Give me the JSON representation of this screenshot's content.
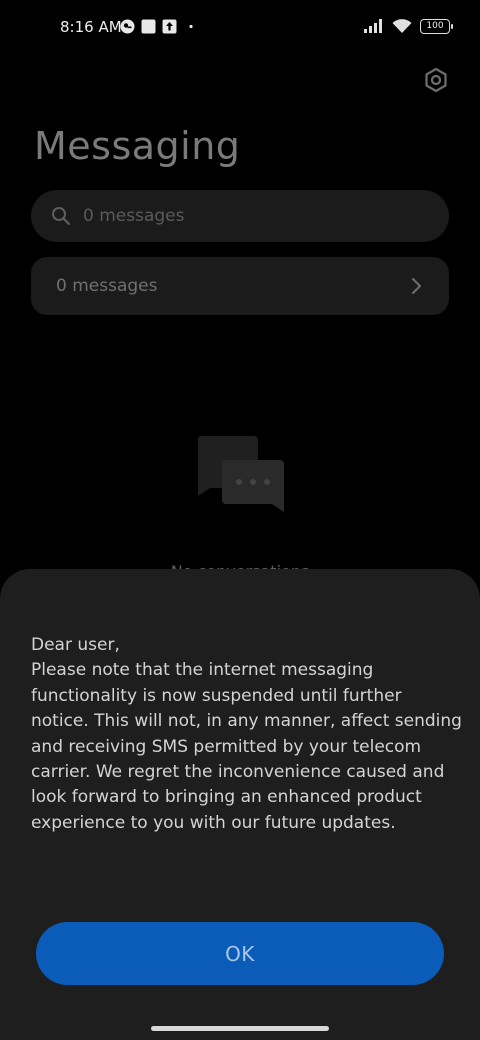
{
  "status_bar": {
    "time": "8:16 AM",
    "battery": "100",
    "left_icons": [
      "vpn-key-icon",
      "square-notification-icon",
      "upload-notification-icon",
      "dot-icon"
    ],
    "right_icons": [
      "signal-icon",
      "wifi-icon",
      "battery-icon"
    ]
  },
  "header": {
    "title": "Messaging",
    "settings_icon": "gear-icon"
  },
  "search": {
    "placeholder": "0 messages"
  },
  "messages_row": {
    "label": "0 messages"
  },
  "empty_state": {
    "icon": "chat-bubbles-icon",
    "text": "No conversations"
  },
  "dialog": {
    "message": "Dear user,\nPlease note that the internet messaging functionality is now suspended until further notice. This will not, in any manner, affect sending and receiving SMS permitted by your telecom carrier. We regret the inconvenience caused and look forward to bringing an enhanced product experience to you with our future updates.",
    "ok_label": "OK"
  },
  "colors": {
    "background": "#000000",
    "sheet": "#1e1e1f",
    "accent": "#0a5cb8",
    "card": "#1b1b1b"
  }
}
